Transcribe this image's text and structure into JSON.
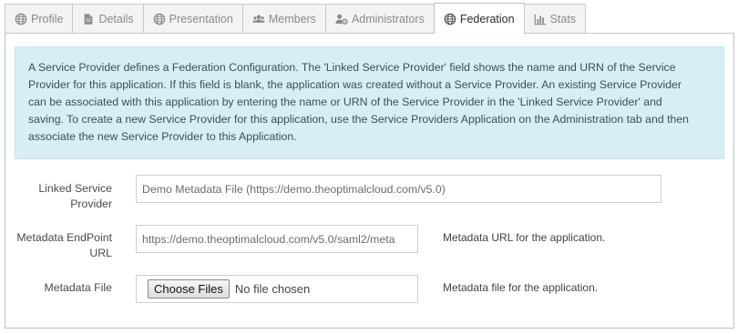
{
  "tabs": [
    {
      "label": "Profile",
      "icon": "globe-icon"
    },
    {
      "label": "Details",
      "icon": "document-icon"
    },
    {
      "label": "Presentation",
      "icon": "globe-icon"
    },
    {
      "label": "Members",
      "icon": "users-icon"
    },
    {
      "label": "Administrators",
      "icon": "user-cog-icon"
    },
    {
      "label": "Federation",
      "icon": "globe-icon",
      "active": true
    },
    {
      "label": "Stats",
      "icon": "bar-chart-icon"
    }
  ],
  "info": {
    "line1": "A Service Provider defines a Federation Configuration. The 'Linked Service Provider' field shows the name and URN of the Service",
    "line2": "Provider for this application. If this field is blank, the application was created without a Service Provider. An existing Service Provider",
    "line3": "can be associated with this application by entering the name or URN of the Service Provider in the 'Linked Service Provider' and",
    "line4": "saving. To create a new Service Provider for this application, use the Service Providers Application on the Administration tab and then",
    "line5": "associate the new Service Provider to this Application."
  },
  "form": {
    "linked_sp": {
      "label_line1": "Linked Service",
      "label_line2": "Provider",
      "value": "Demo Metadata File (https://demo.theoptimalcloud.com/v5.0)"
    },
    "metadata_endpoint": {
      "label_line1": "Metadata EndPoint",
      "label_line2": "URL",
      "value": "https://demo.theoptimalcloud.com/v5.0/saml2/meta",
      "help": "Metadata URL for the application."
    },
    "metadata_file": {
      "label": "Metadata File",
      "button": "Choose Files",
      "status": "No file chosen",
      "help": "Metadata file for the application."
    }
  },
  "colors": {
    "info_bg": "#d9edf7",
    "info_border": "#bce8f1",
    "tab_inactive_text": "#8a8a8a",
    "border": "#c9c9c9"
  }
}
